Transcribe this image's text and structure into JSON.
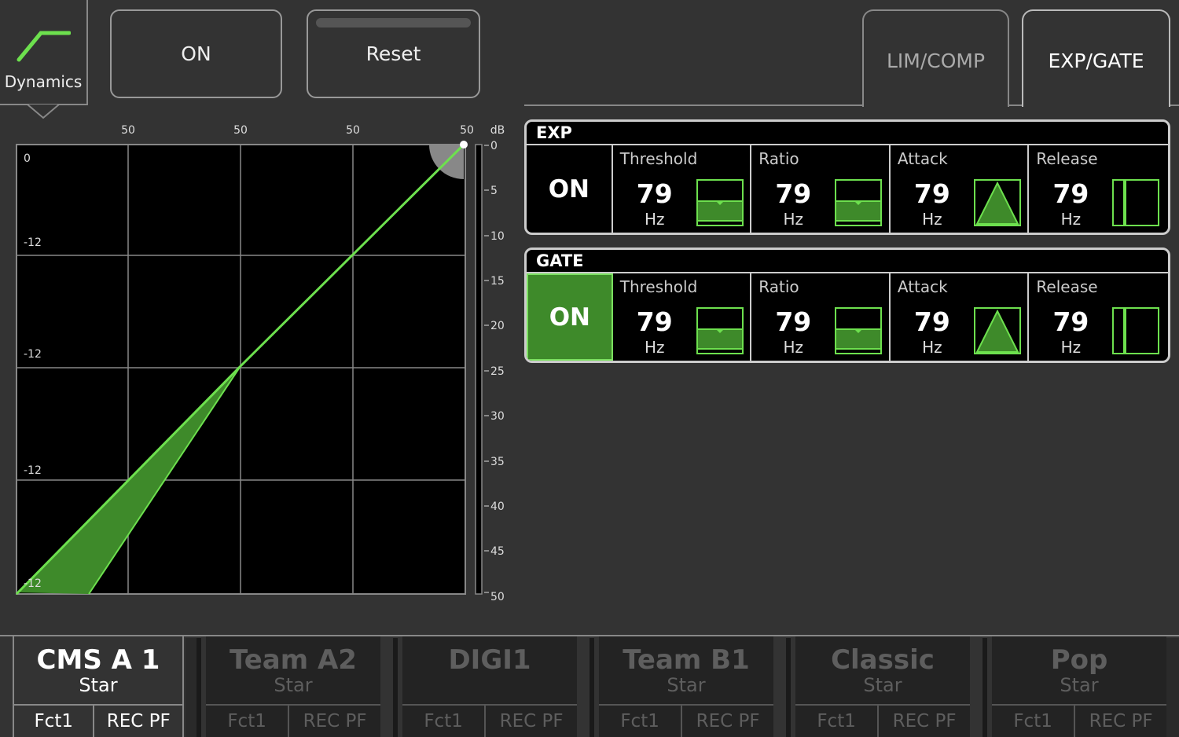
{
  "header": {
    "dynamics_label": "Dynamics",
    "on_label": "ON",
    "reset_label": "Reset"
  },
  "tabs": [
    {
      "label": "LIM/COMP",
      "active": false
    },
    {
      "label": "EXP/GATE",
      "active": true
    }
  ],
  "graph": {
    "top_labels": [
      "50",
      "50",
      "50",
      "50"
    ],
    "db_label": "dB",
    "left_labels": [
      "0",
      "-12",
      "-12",
      "-12",
      "-12"
    ],
    "meter_labels": [
      "0",
      "5",
      "10",
      "15",
      "20",
      "25",
      "30",
      "35",
      "40",
      "45",
      "50"
    ],
    "curve_color": "#6de04e",
    "fill_color": "#3e8a2a"
  },
  "exp": {
    "title": "EXP",
    "on_label": "ON",
    "on_active": false,
    "params": [
      {
        "name": "Threshold",
        "value": "79",
        "unit": "Hz",
        "icon": "threshold-fader-icon"
      },
      {
        "name": "Ratio",
        "value": "79",
        "unit": "Hz",
        "icon": "ratio-fader-icon"
      },
      {
        "name": "Attack",
        "value": "79",
        "unit": "Hz",
        "icon": "attack-triangle-icon"
      },
      {
        "name": "Release",
        "value": "79",
        "unit": "Hz",
        "icon": "release-bar-icon"
      }
    ]
  },
  "gate": {
    "title": "GATE",
    "on_label": "ON",
    "on_active": true,
    "params": [
      {
        "name": "Threshold",
        "value": "79",
        "unit": "Hz",
        "icon": "threshold-fader-icon"
      },
      {
        "name": "Ratio",
        "value": "79",
        "unit": "Hz",
        "icon": "ratio-fader-icon"
      },
      {
        "name": "Attack",
        "value": "79",
        "unit": "Hz",
        "icon": "attack-triangle-icon"
      },
      {
        "name": "Release",
        "value": "79",
        "unit": "Hz",
        "icon": "release-bar-icon"
      }
    ]
  },
  "channels": [
    {
      "name": "CMS A 1",
      "sub": "Star",
      "fct": "Fct1",
      "rec": "REC PF",
      "active": true
    },
    {
      "name": "Team A2",
      "sub": "Star",
      "fct": "Fct1",
      "rec": "REC PF",
      "active": false
    },
    {
      "name": "DIGI1",
      "sub": "",
      "fct": "Fct1",
      "rec": "REC PF",
      "active": false
    },
    {
      "name": "Team B1",
      "sub": "Star",
      "fct": "Fct1",
      "rec": "REC PF",
      "active": false
    },
    {
      "name": "Classic",
      "sub": "Star",
      "fct": "Fct1",
      "rec": "REC PF",
      "active": false
    },
    {
      "name": "Pop",
      "sub": "Star",
      "fct": "Fct1",
      "rec": "REC PF",
      "active": false
    }
  ],
  "colors": {
    "accent": "#6de04e",
    "active_fill": "#3e8a2a",
    "background": "#333333"
  }
}
